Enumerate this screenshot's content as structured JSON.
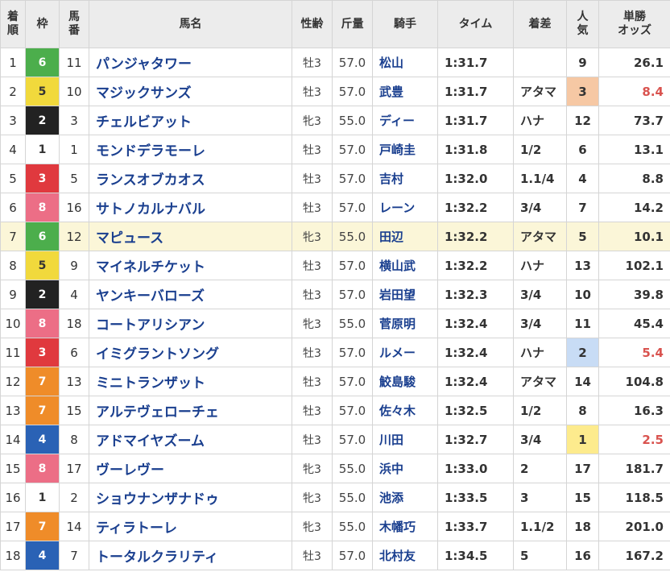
{
  "headers": {
    "rank": [
      "着",
      "順"
    ],
    "waku": [
      "枠"
    ],
    "umaban": [
      "馬",
      "番"
    ],
    "name": [
      "馬名"
    ],
    "sex_age": [
      "性齢"
    ],
    "weight": [
      "斤量"
    ],
    "jockey": [
      "騎手"
    ],
    "time": [
      "タイム"
    ],
    "margin": [
      "着差"
    ],
    "popularity": [
      "人",
      "気"
    ],
    "odds": [
      "単勝",
      "オッズ"
    ]
  },
  "colors": {
    "waku": {
      "1": {
        "bg": "#ffffff",
        "fg": "#333333"
      },
      "2": {
        "bg": "#222222",
        "fg": "#ffffff"
      },
      "3": {
        "bg": "#e0393e",
        "fg": "#ffffff"
      },
      "4": {
        "bg": "#2a62b5",
        "fg": "#ffffff"
      },
      "5": {
        "bg": "#f1d93c",
        "fg": "#333333"
      },
      "6": {
        "bg": "#4cae4c",
        "fg": "#ffffff"
      },
      "7": {
        "bg": "#ef8c29",
        "fg": "#ffffff"
      },
      "8": {
        "bg": "#ec6e86",
        "fg": "#ffffff"
      }
    },
    "popularity_highlight": {
      "1": "#fdeb8d",
      "2": "#c8dcf5",
      "3": "#f6c8a4"
    },
    "favored_odds": "#d9534f"
  },
  "highlighted_row": 7,
  "rows": [
    {
      "rank": "1",
      "waku": "6",
      "umaban": "11",
      "name": "パンジャタワー",
      "sex_age": "牡3",
      "weight": "57.0",
      "jockey": "松山",
      "time": "1:31.7",
      "margin": "",
      "popularity": "9",
      "odds": "26.1"
    },
    {
      "rank": "2",
      "waku": "5",
      "umaban": "10",
      "name": "マジックサンズ",
      "sex_age": "牡3",
      "weight": "57.0",
      "jockey": "武豊",
      "time": "1:31.7",
      "margin": "アタマ",
      "popularity": "3",
      "odds": "8.4"
    },
    {
      "rank": "3",
      "waku": "2",
      "umaban": "3",
      "name": "チェルビアット",
      "sex_age": "牝3",
      "weight": "55.0",
      "jockey": "ディー",
      "time": "1:31.7",
      "margin": "ハナ",
      "popularity": "12",
      "odds": "73.7"
    },
    {
      "rank": "4",
      "waku": "1",
      "umaban": "1",
      "name": "モンドデラモーレ",
      "sex_age": "牡3",
      "weight": "57.0",
      "jockey": "戸崎圭",
      "time": "1:31.8",
      "margin": "1/2",
      "popularity": "6",
      "odds": "13.1"
    },
    {
      "rank": "5",
      "waku": "3",
      "umaban": "5",
      "name": "ランスオブカオス",
      "sex_age": "牡3",
      "weight": "57.0",
      "jockey": "吉村",
      "time": "1:32.0",
      "margin": "1.1/4",
      "popularity": "4",
      "odds": "8.8"
    },
    {
      "rank": "6",
      "waku": "8",
      "umaban": "16",
      "name": "サトノカルナバル",
      "sex_age": "牡3",
      "weight": "57.0",
      "jockey": "レーン",
      "time": "1:32.2",
      "margin": "3/4",
      "popularity": "7",
      "odds": "14.2"
    },
    {
      "rank": "7",
      "waku": "6",
      "umaban": "12",
      "name": "マピュース",
      "sex_age": "牝3",
      "weight": "55.0",
      "jockey": "田辺",
      "time": "1:32.2",
      "margin": "アタマ",
      "popularity": "5",
      "odds": "10.1"
    },
    {
      "rank": "8",
      "waku": "5",
      "umaban": "9",
      "name": "マイネルチケット",
      "sex_age": "牡3",
      "weight": "57.0",
      "jockey": "横山武",
      "time": "1:32.2",
      "margin": "ハナ",
      "popularity": "13",
      "odds": "102.1"
    },
    {
      "rank": "9",
      "waku": "2",
      "umaban": "4",
      "name": "ヤンキーバローズ",
      "sex_age": "牡3",
      "weight": "57.0",
      "jockey": "岩田望",
      "time": "1:32.3",
      "margin": "3/4",
      "popularity": "10",
      "odds": "39.8"
    },
    {
      "rank": "10",
      "waku": "8",
      "umaban": "18",
      "name": "コートアリシアン",
      "sex_age": "牝3",
      "weight": "55.0",
      "jockey": "菅原明",
      "time": "1:32.4",
      "margin": "3/4",
      "popularity": "11",
      "odds": "45.4"
    },
    {
      "rank": "11",
      "waku": "3",
      "umaban": "6",
      "name": "イミグラントソング",
      "sex_age": "牡3",
      "weight": "57.0",
      "jockey": "ルメー",
      "time": "1:32.4",
      "margin": "ハナ",
      "popularity": "2",
      "odds": "5.4"
    },
    {
      "rank": "12",
      "waku": "7",
      "umaban": "13",
      "name": "ミニトランザット",
      "sex_age": "牡3",
      "weight": "57.0",
      "jockey": "鮫島駿",
      "time": "1:32.4",
      "margin": "アタマ",
      "popularity": "14",
      "odds": "104.8"
    },
    {
      "rank": "13",
      "waku": "7",
      "umaban": "15",
      "name": "アルテヴェローチェ",
      "sex_age": "牡3",
      "weight": "57.0",
      "jockey": "佐々木",
      "time": "1:32.5",
      "margin": "1/2",
      "popularity": "8",
      "odds": "16.3"
    },
    {
      "rank": "14",
      "waku": "4",
      "umaban": "8",
      "name": "アドマイヤズーム",
      "sex_age": "牡3",
      "weight": "57.0",
      "jockey": "川田",
      "time": "1:32.7",
      "margin": "3/4",
      "popularity": "1",
      "odds": "2.5"
    },
    {
      "rank": "15",
      "waku": "8",
      "umaban": "17",
      "name": "ヴーレヴー",
      "sex_age": "牝3",
      "weight": "55.0",
      "jockey": "浜中",
      "time": "1:33.0",
      "margin": "2",
      "popularity": "17",
      "odds": "181.7"
    },
    {
      "rank": "16",
      "waku": "1",
      "umaban": "2",
      "name": "ショウナンザナドゥ",
      "sex_age": "牝3",
      "weight": "55.0",
      "jockey": "池添",
      "time": "1:33.5",
      "margin": "3",
      "popularity": "15",
      "odds": "118.5"
    },
    {
      "rank": "17",
      "waku": "7",
      "umaban": "14",
      "name": "ティラトーレ",
      "sex_age": "牝3",
      "weight": "55.0",
      "jockey": "木幡巧",
      "time": "1:33.7",
      "margin": "1.1/2",
      "popularity": "18",
      "odds": "201.0"
    },
    {
      "rank": "18",
      "waku": "4",
      "umaban": "7",
      "name": "トータルクラリティ",
      "sex_age": "牡3",
      "weight": "57.0",
      "jockey": "北村友",
      "time": "1:34.5",
      "margin": "5",
      "popularity": "16",
      "odds": "167.2"
    }
  ]
}
